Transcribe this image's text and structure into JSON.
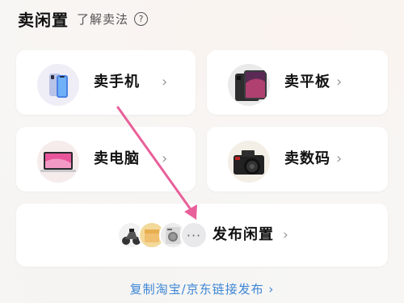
{
  "header": {
    "title": "卖闲置",
    "subtitle": "了解卖法",
    "help_icon": "question-circle-icon"
  },
  "categories": [
    {
      "label": "卖手机",
      "icon": "phone-icon"
    },
    {
      "label": "卖平板",
      "icon": "tablet-icon"
    },
    {
      "label": "卖电脑",
      "icon": "laptop-icon"
    },
    {
      "label": "卖数码",
      "icon": "camera-icon"
    }
  ],
  "publish": {
    "label": "发布闲置",
    "more": "···",
    "icons": [
      "motorcycle-icon",
      "washing-machine-icon",
      "more-icon"
    ]
  },
  "copy_link": {
    "label": "复制淘宝/京东链接发布 ›"
  },
  "colors": {
    "accent_link": "#3d86d6",
    "annotation_arrow": "#e8609a"
  },
  "chevron": "›"
}
